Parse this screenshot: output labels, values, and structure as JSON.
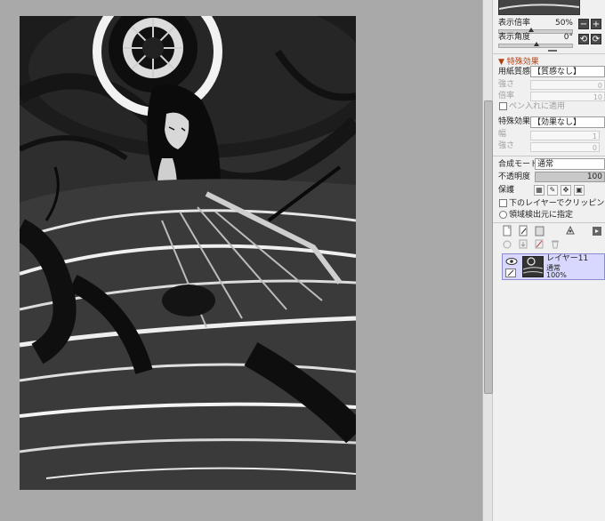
{
  "view": {
    "zoom_label": "表示倍率",
    "zoom_value": "50%",
    "angle_label": "表示角度",
    "angle_value": "0°",
    "zoom_in": "+",
    "zoom_out": "−"
  },
  "special_effects": {
    "section_title": "特殊効果",
    "paper_label": "用紙質感",
    "paper_value": "【質感なし】",
    "strength_label": "強さ",
    "strength_value": "0",
    "scale_label": "倍率",
    "scale_value": "10",
    "apply_to_pen_label": "ペン入れに適用",
    "effect_label": "特殊効果",
    "effect_value": "【効果なし】",
    "width_label": "幅",
    "width_value": "1",
    "effect_strength_label": "強さ",
    "effect_strength_value": "0"
  },
  "layer_props": {
    "blend_label": "合成モード",
    "blend_value": "通常",
    "opacity_label": "不透明度",
    "opacity_value": "100",
    "protect_label": "保護",
    "clip_label": "下のレイヤーでクリッピング",
    "selection_source_label": "領域検出元に指定"
  },
  "layers": [
    {
      "name": "レイヤー11",
      "mode": "通常",
      "opacity": "100%"
    }
  ],
  "colors": {
    "accent_section": "#b04010",
    "layer_selected": "#d8d8ff"
  }
}
